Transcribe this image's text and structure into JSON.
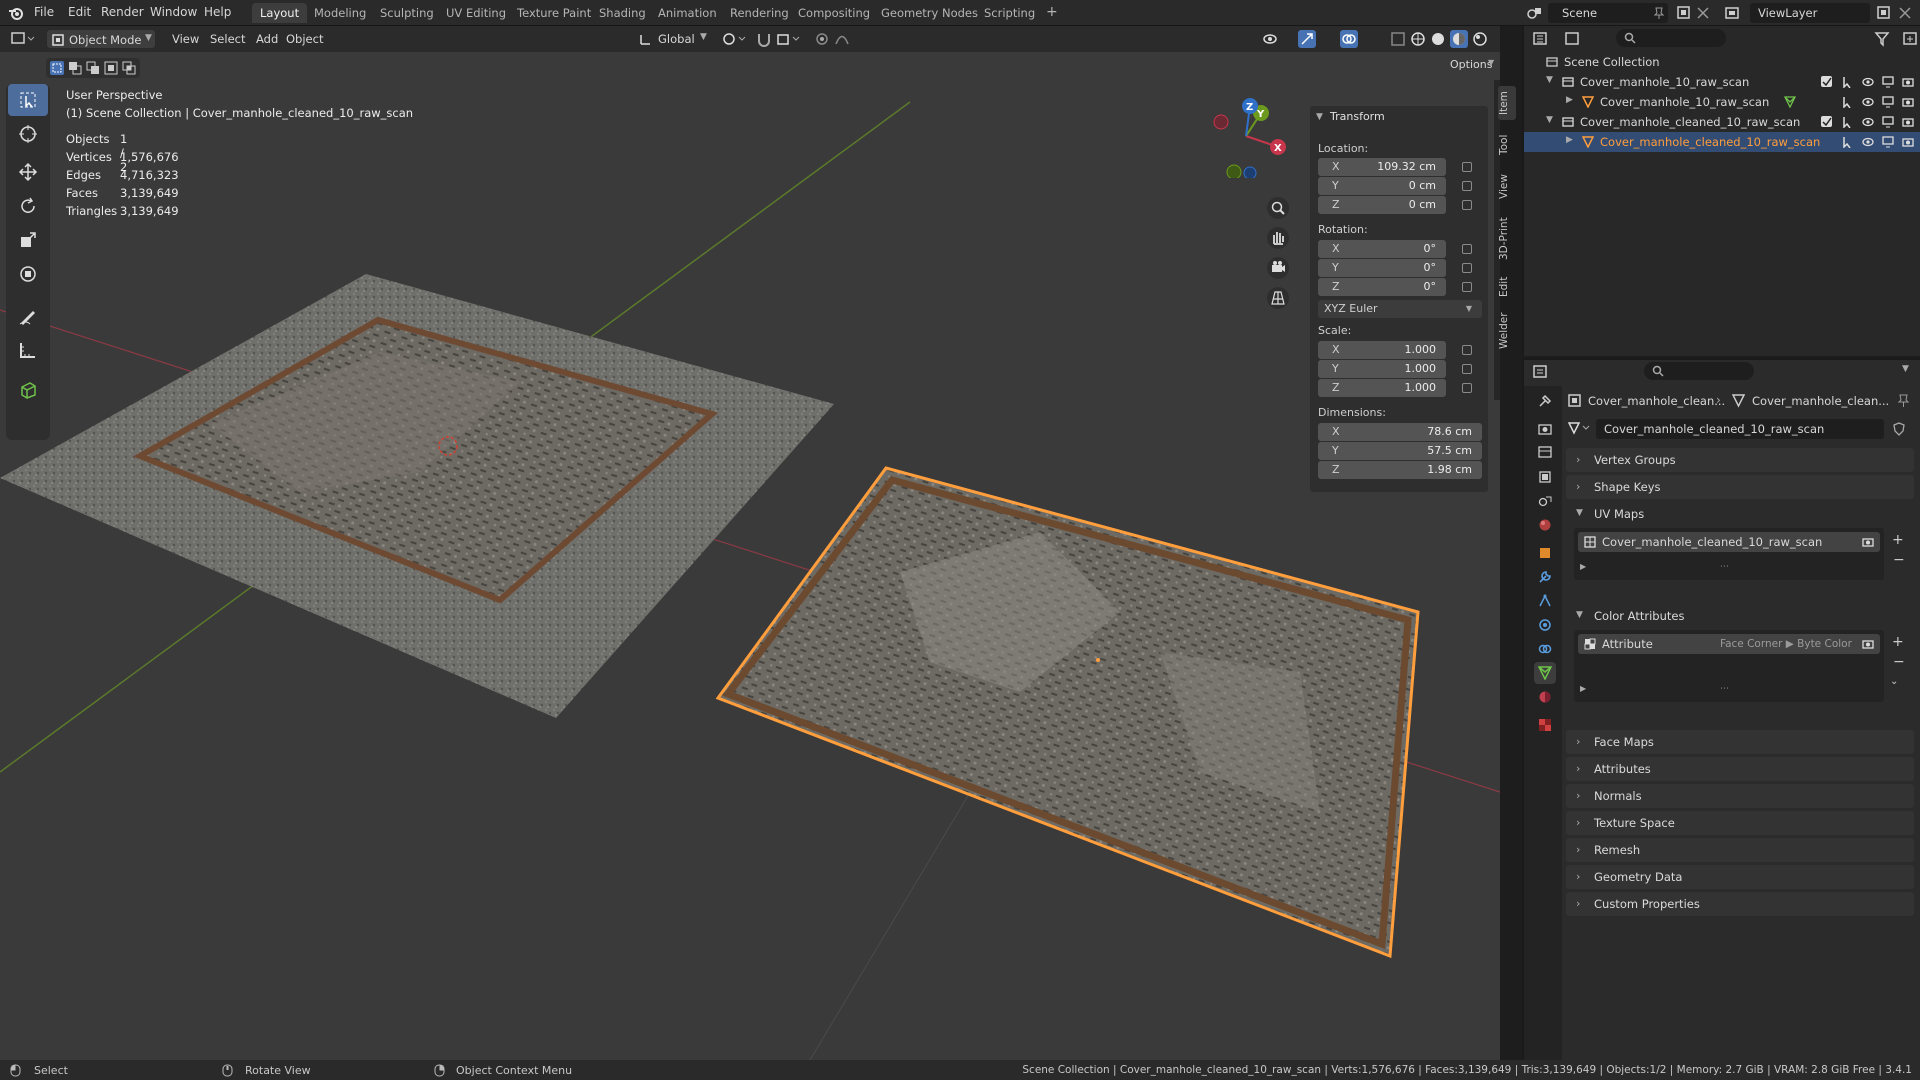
{
  "app": {
    "menus": [
      "File",
      "Edit",
      "Render",
      "Window",
      "Help"
    ],
    "workspaces": [
      "Layout",
      "Modeling",
      "Sculpting",
      "UV Editing",
      "Texture Paint",
      "Shading",
      "Animation",
      "Rendering",
      "Compositing",
      "Geometry Nodes",
      "Scripting"
    ],
    "active_workspace": "Layout",
    "add_workspace": "+",
    "scene_name": "Scene",
    "view_layer": "ViewLayer"
  },
  "viewport": {
    "mode": "Object Mode",
    "menus": [
      "View",
      "Select",
      "Add",
      "Object"
    ],
    "orientation": "Global",
    "options_label": "Options",
    "view_name": "User Perspective",
    "collection_path": "(1) Scene Collection | Cover_manhole_cleaned_10_raw_scan",
    "stats": [
      {
        "label": "Objects",
        "value": "1 / 2"
      },
      {
        "label": "Vertices",
        "value": "1,576,676"
      },
      {
        "label": "Edges",
        "value": "4,716,323"
      },
      {
        "label": "Faces",
        "value": "3,139,649"
      },
      {
        "label": "Triangles",
        "value": "3,139,649"
      }
    ],
    "gizmo_axes": [
      "X",
      "Y",
      "Z"
    ]
  },
  "npanel": {
    "section": "Transform",
    "location_label": "Location:",
    "location": [
      {
        "axis": "X",
        "value": "109.32 cm"
      },
      {
        "axis": "Y",
        "value": "0 cm"
      },
      {
        "axis": "Z",
        "value": "0 cm"
      }
    ],
    "rotation_label": "Rotation:",
    "rotation": [
      {
        "axis": "X",
        "value": "0°"
      },
      {
        "axis": "Y",
        "value": "0°"
      },
      {
        "axis": "Z",
        "value": "0°"
      }
    ],
    "rotation_mode": "XYZ Euler",
    "scale_label": "Scale:",
    "scale": [
      {
        "axis": "X",
        "value": "1.000"
      },
      {
        "axis": "Y",
        "value": "1.000"
      },
      {
        "axis": "Z",
        "value": "1.000"
      }
    ],
    "dimensions_label": "Dimensions:",
    "dimensions": [
      {
        "axis": "X",
        "value": "78.6 cm"
      },
      {
        "axis": "Y",
        "value": "57.5 cm"
      },
      {
        "axis": "Z",
        "value": "1.98 cm"
      }
    ],
    "side_tabs": [
      "Item",
      "Tool",
      "View",
      "3D-Print",
      "Edit",
      "Welder"
    ]
  },
  "outliner": {
    "root": "Scene Collection",
    "rows": [
      {
        "name": "Cover_manhole_10_raw_scan",
        "level": 1,
        "kind": "collection"
      },
      {
        "name": "Cover_manhole_10_raw_scan",
        "level": 2,
        "kind": "mesh"
      },
      {
        "name": "Cover_manhole_cleaned_10_raw_scan",
        "level": 1,
        "kind": "collection"
      },
      {
        "name": "Cover_manhole_cleaned_10_raw_scan",
        "level": 2,
        "kind": "mesh",
        "selected": true
      }
    ]
  },
  "properties": {
    "breadcrumb": [
      "Cover_manhole_clean...",
      "Cover_manhole_clean..."
    ],
    "mesh_name": "Cover_manhole_cleaned_10_raw_scan",
    "panels_top": [
      "Vertex Groups",
      "Shape Keys"
    ],
    "uv_maps": {
      "title": "UV Maps",
      "items": [
        "Cover_manhole_cleaned_10_raw_scan"
      ]
    },
    "color_attributes": {
      "title": "Color Attributes",
      "item": "Attribute",
      "domain": "Face Corner ▶ Byte Color"
    },
    "panels_bottom": [
      "Face Maps",
      "Attributes",
      "Normals",
      "Texture Space",
      "Remesh",
      "Geometry Data",
      "Custom Properties"
    ]
  },
  "statusbar": {
    "hints": [
      "Select",
      "Rotate View",
      "Object Context Menu"
    ],
    "info": "Scene Collection | Cover_manhole_cleaned_10_raw_scan | Verts:1,576,676 | Faces:3,139,649 | Tris:3,139,649 | Objects:1/2 | Memory: 2.7 GiB | VRAM: 2.8 GiB Free | 3.4.1"
  },
  "colors": {
    "accent_blue": "#4772b3",
    "selected_orange": "#ff9e3d",
    "axis_red": "#c7364b",
    "axis_green": "#6b9a1f",
    "axis_blue": "#2f70c9"
  }
}
